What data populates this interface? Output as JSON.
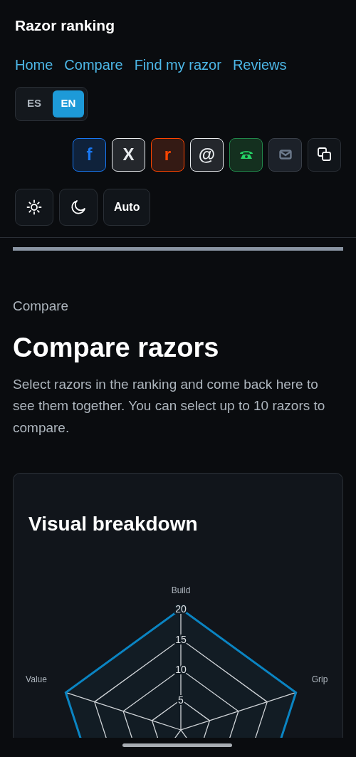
{
  "header": {
    "title": "Razor ranking"
  },
  "nav": [
    "Home",
    "Compare",
    "Find my razor",
    "Reviews"
  ],
  "languages": [
    {
      "label": "ES",
      "selected": false
    },
    {
      "label": "EN",
      "selected": true
    }
  ],
  "share_buttons": [
    {
      "kind": "facebook",
      "label": "f",
      "color": "#1877f2"
    },
    {
      "kind": "x",
      "label": "X",
      "color": "#e9ecef"
    },
    {
      "kind": "reddit",
      "label": "r",
      "color": "#ff4500"
    },
    {
      "kind": "threads",
      "label": "@",
      "color": "#e9ecef"
    },
    {
      "kind": "phone",
      "color": "#25d366"
    },
    {
      "kind": "mail",
      "color": "#6c7a8c"
    },
    {
      "kind": "copy",
      "color": "#ffffff"
    }
  ],
  "theme_buttons": [
    {
      "kind": "sun"
    },
    {
      "kind": "moon"
    },
    {
      "kind": "text",
      "label": "Auto"
    }
  ],
  "breadcrumb": "Compare",
  "heading": "Compare razors",
  "intro": "Select razors in the ranking and come back here to see them together. You can select up to 10 razors to compare.",
  "card": {
    "title": "Visual breakdown",
    "radar": {
      "axes": [
        "Build",
        "Grip",
        "Value"
      ],
      "ticks": [
        "20",
        "15",
        "10",
        "5"
      ]
    }
  }
}
